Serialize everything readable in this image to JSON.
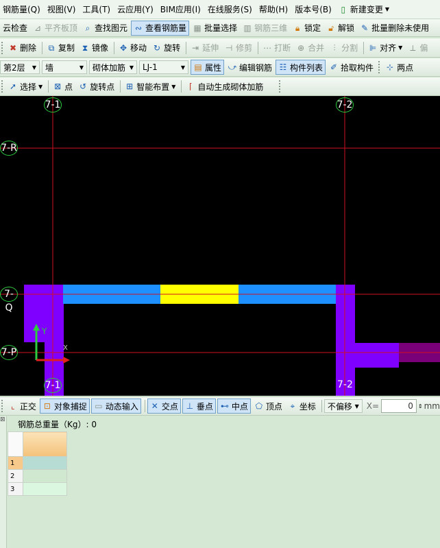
{
  "menu": [
    "钢筋量(Q)",
    "视图(V)",
    "工具(T)",
    "云应用(Y)",
    "BIM应用(I)",
    "在线服务(S)",
    "帮助(H)",
    "版本号(B)",
    "新建变更"
  ],
  "toolbar1": {
    "cloud_check": "云检查",
    "flush_slab": "平齐板顶",
    "find_element": "查找图元",
    "view_rebar": "查看钢筋量",
    "batch_select": "批量选择",
    "rebar_3d": "钢筋三维",
    "lock": "锁定",
    "unlock": "解锁",
    "batch_delete": "批量删除未使用"
  },
  "toolbar2": {
    "delete": "删除",
    "copy": "复制",
    "mirror": "镜像",
    "move": "移动",
    "rotate": "旋转",
    "extend": "延伸",
    "trim": "修剪",
    "break": "打断",
    "merge": "合并",
    "split": "分割",
    "align": "对齐",
    "offset": "偏"
  },
  "toolbar3": {
    "floor": "第2层",
    "category": "墙",
    "component_type": "砌体加筋",
    "component": "LJ-1",
    "properties": "属性",
    "edit_rebar": "编辑钢筋",
    "component_list": "构件列表",
    "pick_component": "拾取构件",
    "two_points": "两点"
  },
  "toolbar4": {
    "select": "选择",
    "point": "点",
    "rotate_point": "旋转点",
    "smart_layout": "智能布置",
    "auto_generate": "自动生成砌体加筋"
  },
  "canvas": {
    "axes": {
      "v1_top": "7-1",
      "v2_top": "7-2",
      "v1_bottom": "7-1",
      "v2_bottom": "7-2",
      "h_r": "7-R",
      "h_q": "7-Q",
      "h_p": "7-P"
    },
    "ucs_y": "Y",
    "ucs_x": "X",
    "colors": {
      "grid_line": "#d01020",
      "column": "#7f00ff",
      "wall": "#1e90ff",
      "rebar": "#ffff00",
      "bubble": "#2ecc40"
    }
  },
  "snapbar": {
    "ortho": "正交",
    "object_snap": "对象捕捉",
    "dynamic_input": "动态输入",
    "intersection": "交点",
    "perpendicular": "垂点",
    "midpoint": "中点",
    "vertex": "顶点",
    "coordinate": "坐标",
    "offset_mode": "不偏移",
    "x_label": "X=",
    "x_value": "0",
    "unit": "mm"
  },
  "panel": {
    "title": "钢筋总重量（Kg）: 0",
    "rows": [
      "1",
      "2",
      "3"
    ]
  }
}
